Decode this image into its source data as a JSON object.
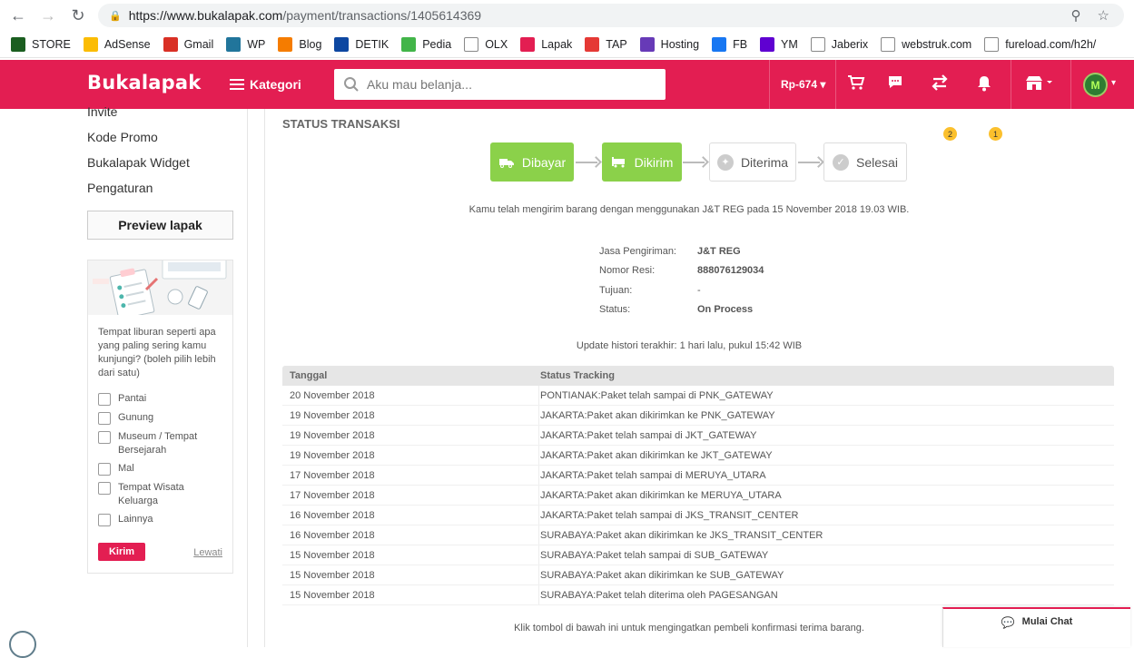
{
  "browser": {
    "url_host": "https://www.bukalapak.com",
    "url_path": "/payment/transactions/1405614369",
    "bookmarks": [
      {
        "label": "STORE",
        "icon": "m-icon",
        "color": "#1b5e20"
      },
      {
        "label": "AdSense",
        "icon": "adsense-icon",
        "color": "#fbbc04"
      },
      {
        "label": "Gmail",
        "icon": "gmail-icon",
        "color": "#d93025"
      },
      {
        "label": "WP",
        "icon": "wordpress-icon",
        "color": "#21759b"
      },
      {
        "label": "Blog",
        "icon": "blogger-icon",
        "color": "#f57c00"
      },
      {
        "label": "DETIK",
        "icon": "detik-icon",
        "color": "#0d47a1"
      },
      {
        "label": "Pedia",
        "icon": "tokopedia-icon",
        "color": "#42b549"
      },
      {
        "label": "OLX",
        "icon": "olx-icon",
        "color": "#ffffff"
      },
      {
        "label": "Lapak",
        "icon": "bl-icon",
        "color": "#e31e52"
      },
      {
        "label": "TAP",
        "icon": "tap-icon",
        "color": "#e53935"
      },
      {
        "label": "Hosting",
        "icon": "hostinger-icon",
        "color": "#673ab7"
      },
      {
        "label": "FB",
        "icon": "facebook-icon",
        "color": "#1877f2"
      },
      {
        "label": "YM",
        "icon": "yahoo-icon",
        "color": "#5f01d1"
      },
      {
        "label": "Jaberix",
        "icon": "page-icon",
        "color": "#ffffff"
      },
      {
        "label": "webstruk.com",
        "icon": "globe-icon",
        "color": "#ffffff"
      },
      {
        "label": "fureload.com/h2h/",
        "icon": "page-icon",
        "color": "#ffffff"
      }
    ]
  },
  "header": {
    "logo": "Bukalapak",
    "kategori": "Kategori",
    "search_placeholder": "Aku mau belanja...",
    "saldo": "Rp-674",
    "transaction_badge": "2",
    "notification_badge": "1",
    "brand_color": "#e31e52"
  },
  "sidebar": {
    "links": [
      "Invite",
      "Kode Promo",
      "Bukalapak Widget",
      "Pengaturan"
    ],
    "preview_button": "Preview lapak",
    "survey": {
      "question": "Tempat liburan seperti apa yang paling sering kamu kunjungi? (boleh pilih lebih dari satu)",
      "options": [
        "Pantai",
        "Gunung",
        "Museum / Tempat Bersejarah",
        "Mal",
        "Tempat Wisata Keluarga",
        "Lainnya"
      ],
      "submit": "Kirim",
      "skip": "Lewati"
    }
  },
  "main": {
    "title": "STATUS TRANSAKSI",
    "steps": [
      {
        "label": "Dibayar",
        "state": "done"
      },
      {
        "label": "Dikirim",
        "state": "done"
      },
      {
        "label": "Diterima",
        "state": "todo"
      },
      {
        "label": "Selesai",
        "state": "todo"
      }
    ],
    "shipping_message": "Kamu telah mengirim barang dengan menggunakan J&T REG pada 15 November 2018 19.03 WIB.",
    "info": [
      {
        "label": "Jasa Pengiriman:",
        "value": "J&T REG",
        "bold": true
      },
      {
        "label": "Nomor Resi:",
        "value": "888076129034",
        "bold": true
      },
      {
        "label": "Tujuan:",
        "value": "-",
        "bold": false
      },
      {
        "label": "Status:",
        "value": "On Process",
        "bold": true
      }
    ],
    "update_message": "Update histori terakhir: 1 hari lalu, pukul 15:42 WIB",
    "tracking": {
      "headers": [
        "Tanggal",
        "Status Tracking"
      ],
      "rows": [
        [
          "20 November 2018",
          "PONTIANAK:Paket telah sampai di PNK_GATEWAY"
        ],
        [
          "19 November 2018",
          "JAKARTA:Paket akan dikirimkan ke PNK_GATEWAY"
        ],
        [
          "19 November 2018",
          "JAKARTA:Paket telah sampai di JKT_GATEWAY"
        ],
        [
          "19 November 2018",
          "JAKARTA:Paket akan dikirimkan ke JKT_GATEWAY"
        ],
        [
          "17 November 2018",
          "JAKARTA:Paket telah sampai di MERUYA_UTARA"
        ],
        [
          "17 November 2018",
          "JAKARTA:Paket akan dikirimkan ke MERUYA_UTARA"
        ],
        [
          "16 November 2018",
          "JAKARTA:Paket telah sampai di JKS_TRANSIT_CENTER"
        ],
        [
          "16 November 2018",
          "SURABAYA:Paket akan dikirimkan ke JKS_TRANSIT_CENTER"
        ],
        [
          "15 November 2018",
          "SURABAYA:Paket telah sampai di SUB_GATEWAY"
        ],
        [
          "15 November 2018",
          "SURABAYA:Paket akan dikirimkan ke SUB_GATEWAY"
        ],
        [
          "15 November 2018",
          "SURABAYA:Paket telah diterima oleh PAGESANGAN"
        ]
      ]
    },
    "confirm_message": "Klik tombol di bawah ini untuk mengingatkan pembeli konfirmasi terima barang."
  },
  "chat": {
    "label": "Mulai Chat"
  }
}
